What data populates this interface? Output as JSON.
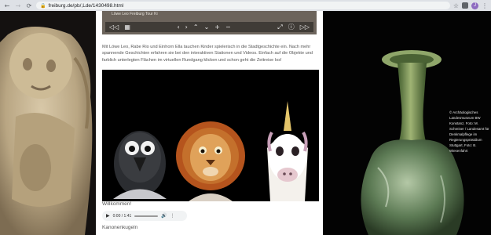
{
  "browser": {
    "url": "freiburg.de/pb/,Lde/1430498.html",
    "back_icon": "arrow-left-icon",
    "forward_icon": "arrow-right-icon",
    "reload_icon": "reload-icon",
    "lock_icon": "lock-icon",
    "star_icon": "star-icon",
    "profile_initial": "J"
  },
  "panorama": {
    "title": "Löwe Leo Freiburg Tour Ki"
  },
  "intro_text": "Mit Löwe Leo, Rabe Rio und Einhorn Ella tauchen Kinder spielerisch in die Stadtgeschichte ein. Nach mehr spannende Geschichten erfahren sie bei den interaktiven Stationen und Videos. Einfach auf die Objekte und farblich unterlegten Flächen im virtuellen Rundgang klicken und schon geht die Zeitreise los!",
  "welcome_heading": "Willkommen!",
  "audio": {
    "time": "0:00 / 1:41"
  },
  "kanon_heading": "Kanonenkugeln",
  "caption": "© Archäologisches Landesmuseum BW Konstanz, Foto: M. Schreiner / Landesamt für Denkmalpflege im Regierungspräsidium Stuttgart, Foto: B. Wiesenfahrt",
  "colors": {
    "chrome": "#dee1e6",
    "content_bg": "#ffffff",
    "text": "#555555",
    "profile": "#8e6cc0"
  }
}
